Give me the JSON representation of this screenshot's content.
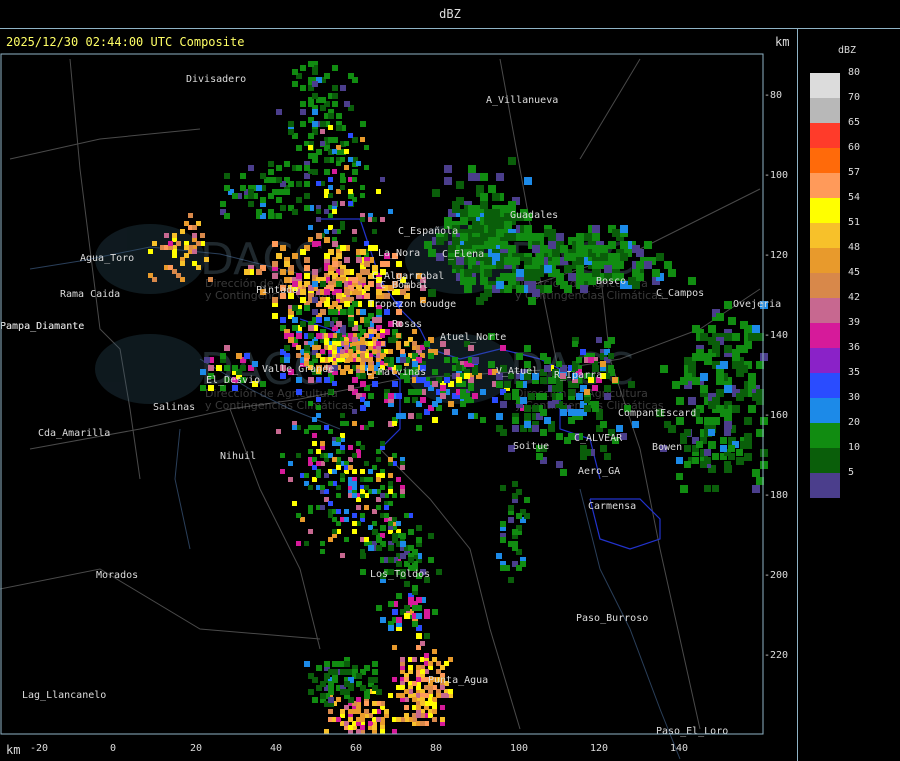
{
  "window": {
    "title": "dBZ"
  },
  "header": {
    "timestamp": "2025/12/30 02:44:00 UTC Composite",
    "km_label": "km",
    "km_label_bottom": "km"
  },
  "legend": {
    "unit": "dBZ",
    "levels": [
      {
        "label": "80",
        "color": "#dcdcdc"
      },
      {
        "label": "70",
        "color": "#b8b8b8"
      },
      {
        "label": "65",
        "color": "#ff3b2a"
      },
      {
        "label": "60",
        "color": "#ff6a0a"
      },
      {
        "label": "57",
        "color": "#ff9a5a"
      },
      {
        "label": "54",
        "color": "#ffff00"
      },
      {
        "label": "51",
        "color": "#f7c12a"
      },
      {
        "label": "48",
        "color": "#e89a2c"
      },
      {
        "label": "45",
        "color": "#d8884a"
      },
      {
        "label": "42",
        "color": "#c76890"
      },
      {
        "label": "39",
        "color": "#d61a9a"
      },
      {
        "label": "36",
        "color": "#8a22c8"
      },
      {
        "label": "35",
        "color": "#2a4cff"
      },
      {
        "label": "30",
        "color": "#1c8ae8"
      },
      {
        "label": "20",
        "color": "#118c11"
      },
      {
        "label": "10",
        "color": "#0a5e0a"
      },
      {
        "label": "5",
        "color": "#4b3e8c"
      }
    ]
  },
  "axes": {
    "x_ticks": [
      "-20",
      "0",
      "20",
      "40",
      "60",
      "80",
      "100",
      "120",
      "140"
    ],
    "y_ticks": [
      "-80",
      "-100",
      "-120",
      "-140",
      "-160",
      "-180",
      "-200",
      "-220"
    ]
  },
  "places": [
    {
      "name": "Divisadero"
    },
    {
      "name": "A_Villanueva"
    },
    {
      "name": "Guadales"
    },
    {
      "name": "Agua_Toro"
    },
    {
      "name": "Pampa_Diamante"
    },
    {
      "name": "Rama Caida"
    },
    {
      "name": "C_Española"
    },
    {
      "name": "La_Nora"
    },
    {
      "name": "C_Elena"
    },
    {
      "name": "Pintado"
    },
    {
      "name": "C_Algarrobal"
    },
    {
      "name": "C_Bombal"
    },
    {
      "name": "Tropezon"
    },
    {
      "name": "Goudge"
    },
    {
      "name": "Atuel_Norte"
    },
    {
      "name": "Rosas"
    },
    {
      "name": "El_Desvio"
    },
    {
      "name": "Valle_Grande"
    },
    {
      "name": "L_Malvinas"
    },
    {
      "name": "V_Atuel"
    },
    {
      "name": "R_Iparra"
    },
    {
      "name": "Salinas"
    },
    {
      "name": "Cda_Amarilla"
    },
    {
      "name": "Nihuil"
    },
    {
      "name": "Soitue"
    },
    {
      "name": "C_ALVEAR"
    },
    {
      "name": "Bowen"
    },
    {
      "name": "CompantEscard"
    },
    {
      "name": "Aero_GA"
    },
    {
      "name": "Carmensa"
    },
    {
      "name": "Bosco"
    },
    {
      "name": "C_Campos"
    },
    {
      "name": "Ovejeria"
    },
    {
      "name": "Morados"
    },
    {
      "name": "Los_Toldos"
    },
    {
      "name": "Paso_Burroso"
    },
    {
      "name": "Punta_Agua"
    },
    {
      "name": "Paso_El_Loro"
    },
    {
      "name": "Lag_Llancanelo"
    },
    {
      "name": "Pampa_Diamante"
    }
  ],
  "watermark": {
    "brand": "DACC",
    "text1": "Dirección de Agricultura",
    "text2": "y Contingencias Climáticas"
  },
  "colors": {
    "accent_line": "#8fb3c6",
    "header_text": "#ffff66",
    "boundary": "#2233cc"
  }
}
